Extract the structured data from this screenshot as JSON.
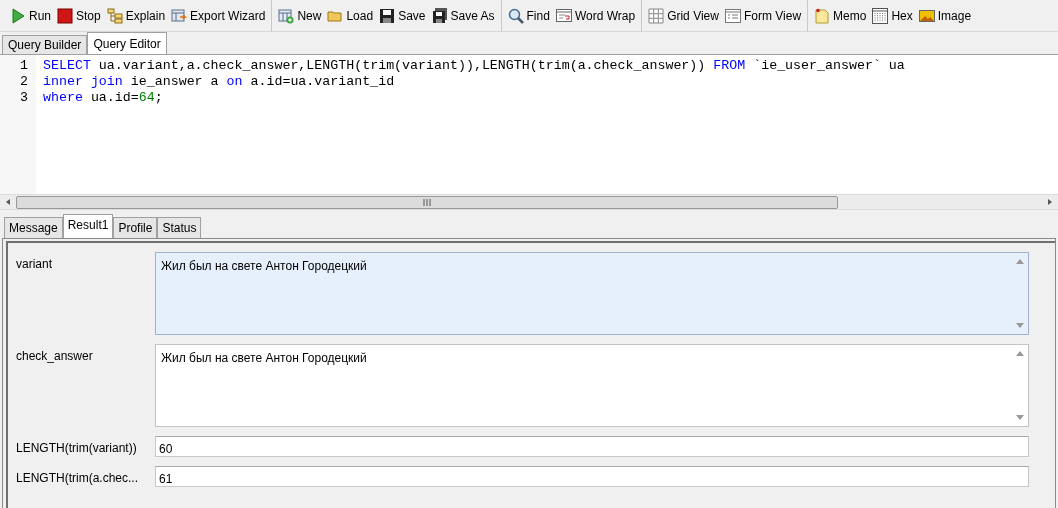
{
  "toolbar": {
    "groups": [
      [
        {
          "label": "Run",
          "kind": "run"
        },
        {
          "label": "Stop",
          "kind": "stop"
        },
        {
          "label": "Explain",
          "kind": "explain"
        },
        {
          "label": "Export Wizard",
          "kind": "export"
        }
      ],
      [
        {
          "label": "New",
          "kind": "new"
        },
        {
          "label": "Load",
          "kind": "load"
        },
        {
          "label": "Save",
          "kind": "save"
        },
        {
          "label": "Save As",
          "kind": "saveas"
        }
      ],
      [
        {
          "label": "Find",
          "kind": "find"
        },
        {
          "label": "Word Wrap",
          "kind": "wrap"
        }
      ],
      [
        {
          "label": "Grid View",
          "kind": "grid"
        },
        {
          "label": "Form View",
          "kind": "form"
        }
      ],
      [
        {
          "label": "Memo",
          "kind": "memo"
        },
        {
          "label": "Hex",
          "kind": "hex"
        },
        {
          "label": "Image",
          "kind": "image"
        }
      ]
    ]
  },
  "editor_tabs": [
    {
      "label": "Query Builder",
      "selected": false
    },
    {
      "label": "Query Editor",
      "selected": true
    }
  ],
  "editor": {
    "lines": [
      {
        "number": "1",
        "tokens": [
          {
            "kind": "keyword",
            "text": "SELECT"
          },
          {
            "kind": "plain",
            "text": " ua.variant,a.check_answer,LENGTH(trim(variant)),LENGTH(trim(a.check_answer)) "
          },
          {
            "kind": "keyword",
            "text": "FROM"
          },
          {
            "kind": "plain",
            "text": " `ie_user_answer` ua"
          }
        ]
      },
      {
        "number": "2",
        "tokens": [
          {
            "kind": "keyword",
            "text": "inner join"
          },
          {
            "kind": "plain",
            "text": " ie_answer a "
          },
          {
            "kind": "keyword",
            "text": "on"
          },
          {
            "kind": "plain",
            "text": " a.id=ua.variant_id"
          }
        ]
      },
      {
        "number": "3",
        "tokens": [
          {
            "kind": "keyword",
            "text": "where"
          },
          {
            "kind": "plain",
            "text": " ua.id="
          },
          {
            "kind": "number",
            "text": "64"
          },
          {
            "kind": "plain",
            "text": ";"
          }
        ]
      }
    ]
  },
  "result_tabs": [
    {
      "label": "Message",
      "selected": false
    },
    {
      "label": "Result1",
      "selected": true
    },
    {
      "label": "Profile",
      "selected": false
    },
    {
      "label": "Status",
      "selected": false
    }
  ],
  "form": {
    "fields": [
      {
        "label": "variant",
        "value": "Жил был на свете Антон Городецкий",
        "kind": "memo",
        "selected": true
      },
      {
        "label": "check_answer",
        "value": "Жил был на свете Антон Городецкий",
        "kind": "memo",
        "selected": false
      },
      {
        "label": "LENGTH(trim(variant))",
        "value": "60",
        "kind": "line",
        "selected": false
      },
      {
        "label": "LENGTH(trim(a.chec...",
        "value": "61",
        "kind": "line",
        "selected": false
      }
    ]
  }
}
